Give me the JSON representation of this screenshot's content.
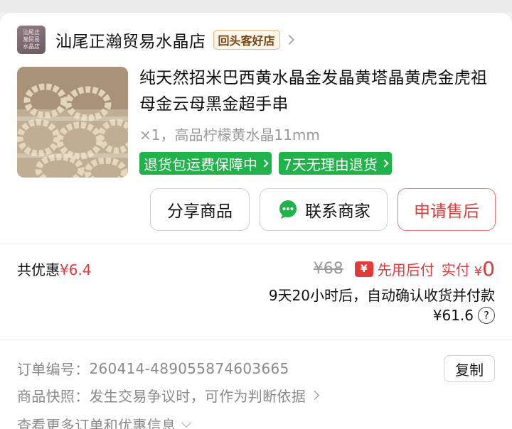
{
  "shop": {
    "logo_text": "汕尾正瀚贸易水晶店",
    "name": "汕尾正瀚贸易水晶店",
    "badge": "回头客好店"
  },
  "product": {
    "title": "纯天然招米巴西黄水晶金发晶黄塔晶黄虎金虎祖母金云母黑金超手串",
    "spec": "×1，高品柠檬黄水晶11mm",
    "tags": [
      "退货包运费保障中",
      "7天无理由退货"
    ]
  },
  "actions": {
    "share": "分享商品",
    "contact": "联系商家",
    "after_sale": "申请售后"
  },
  "price": {
    "discount_label": "共优惠",
    "discount_amount": "¥6.4",
    "original": "¥68",
    "pay_icon": "¥",
    "pay_later": "先用后付",
    "actual_label": "实付",
    "actual_currency": "¥",
    "actual_value": "0",
    "auto_confirm": "9天20小时后，自动确认收货并付款",
    "final_amount": "¥61.6",
    "help": "?"
  },
  "order": {
    "number_label": "订单编号：",
    "number": "260414-489055874603665",
    "copy": "复制",
    "snapshot_label": "商品快照：",
    "snapshot_text": "发生交易争议时，可作为判断依据",
    "more": "查看更多订单和优惠信息"
  },
  "colors": {
    "accent_red": "#e23b3b",
    "tag_green": "#1fb34a",
    "badge_bg": "#fff6ea"
  },
  "icons": [
    "shop-logo",
    "chevron-right-icon",
    "chat-bubble-icon",
    "yuan-pay-icon",
    "help-icon",
    "chevron-down-icon"
  ]
}
